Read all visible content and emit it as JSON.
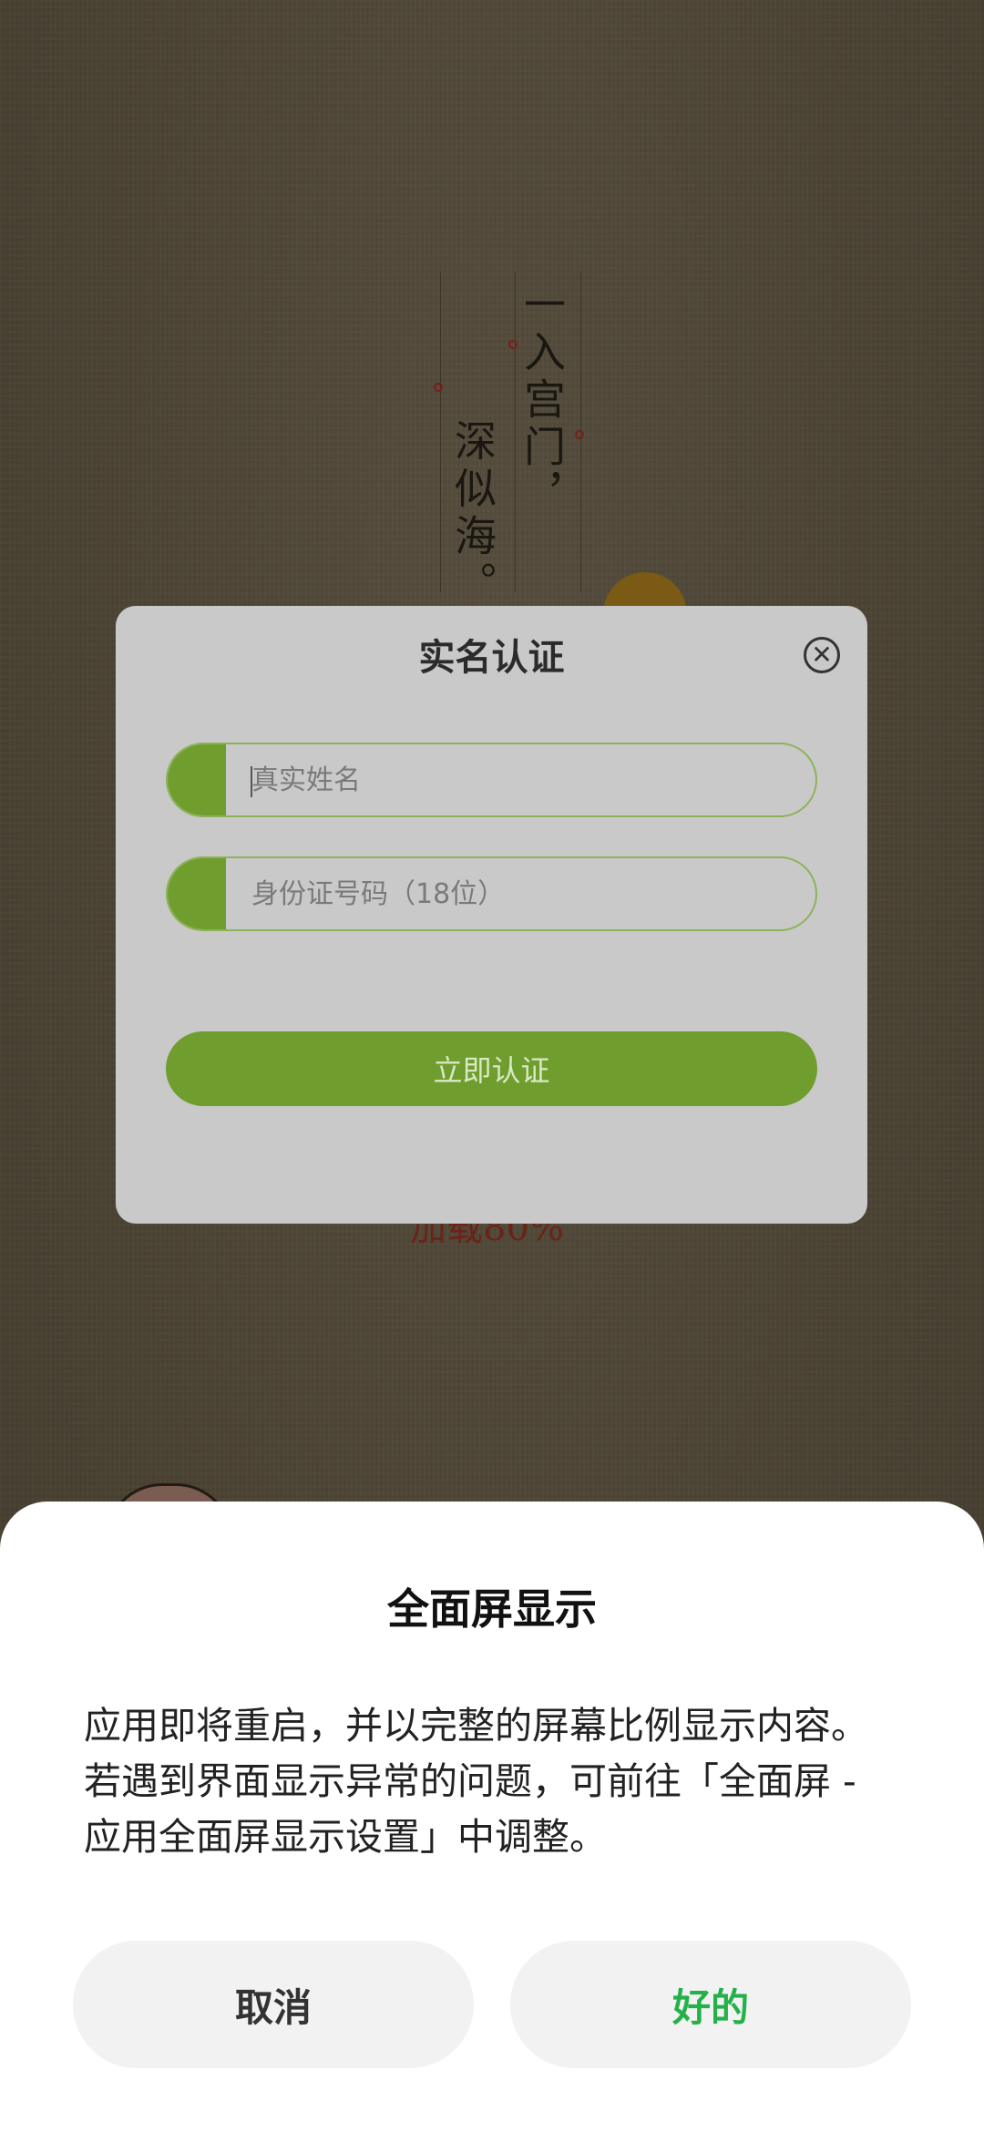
{
  "background": {
    "poem_line_1": "一入宫门，",
    "poem_line_2": "深似海。",
    "loading_text": "加载80%"
  },
  "verify_dialog": {
    "title": "实名认证",
    "close_icon": "close-circle-icon",
    "name_placeholder": "真实姓名",
    "id_placeholder": "身份证号码（18位）",
    "submit_label": "立即认证",
    "accent_color": "#6f9e2e"
  },
  "fullscreen_sheet": {
    "title": "全面屏显示",
    "body": "应用即将重启，并以完整的屏幕比例显示内容。若遇到界面显示异常的问题，可前往「全面屏 - 应用全面屏显示设置」中调整。",
    "cancel_label": "取消",
    "ok_label": "好的",
    "ok_color": "#25b14a"
  }
}
